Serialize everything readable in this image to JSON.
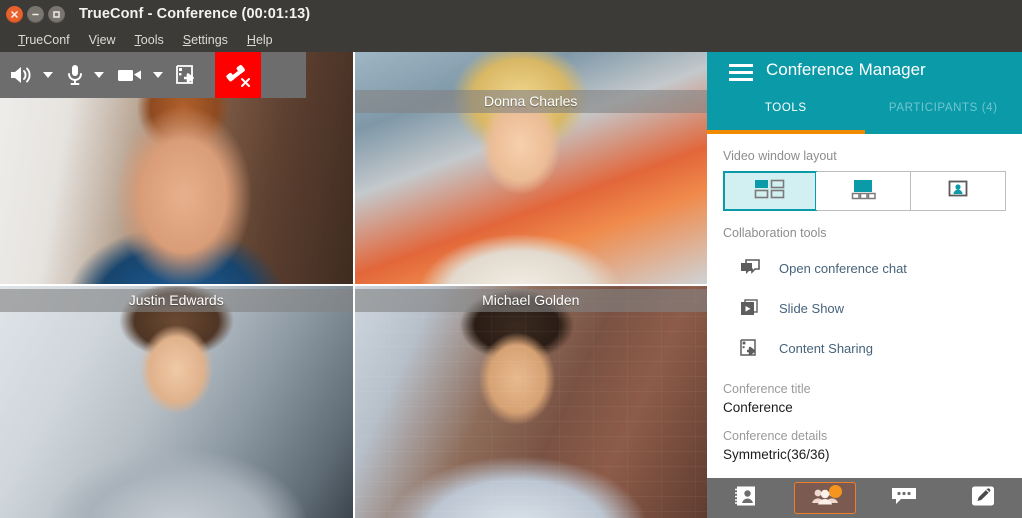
{
  "window": {
    "title": "TrueConf - Conference (00:01:13)",
    "controls": [
      {
        "name": "close",
        "icon": "close-icon"
      },
      {
        "name": "minimize",
        "icon": "minimize-icon"
      },
      {
        "name": "maximize",
        "icon": "maximize-icon"
      }
    ]
  },
  "menubar": {
    "items": [
      {
        "label": "TrueConf",
        "mnemonic": "T"
      },
      {
        "label": "View",
        "mnemonic": "V"
      },
      {
        "label": "Tools",
        "mnemonic": "T"
      },
      {
        "label": "Settings",
        "mnemonic": "S"
      },
      {
        "label": "Help",
        "mnemonic": "H"
      }
    ]
  },
  "toolbar": {
    "buttons": [
      {
        "name": "speaker-button",
        "icon": "speaker-icon",
        "has_dropdown": true
      },
      {
        "name": "microphone-button",
        "icon": "microphone-icon",
        "has_dropdown": true
      },
      {
        "name": "camera-button",
        "icon": "camera-icon",
        "has_dropdown": true
      },
      {
        "name": "content-share-button",
        "icon": "content-share-icon",
        "has_dropdown": false
      },
      {
        "name": "hangup-button",
        "icon": "hangup-icon",
        "has_dropdown": false
      }
    ],
    "hangup_color": "#ff0000"
  },
  "video_grid": {
    "participants": [
      {
        "name": "",
        "position": "top-left"
      },
      {
        "name": "Donna Charles",
        "position": "top-right"
      },
      {
        "name": "Justin Edwards",
        "position": "bottom-left"
      },
      {
        "name": "Michael Golden",
        "position": "bottom-right"
      }
    ]
  },
  "panel": {
    "header": {
      "title": "Conference Manager",
      "menu_icon": "hamburger-icon",
      "background": "#0b9aa8"
    },
    "tabs": [
      {
        "label": "TOOLS",
        "active": true
      },
      {
        "label": "PARTICIPANTS (4)",
        "active": false
      }
    ],
    "accent_color": "#f08a00",
    "layout_section": {
      "label": "Video window layout",
      "options": [
        {
          "name": "grid-layout",
          "icon": "grid-layout-icon",
          "selected": true
        },
        {
          "name": "speaker-layout",
          "icon": "speaker-layout-icon",
          "selected": false
        },
        {
          "name": "single-layout",
          "icon": "single-layout-icon",
          "selected": false
        }
      ]
    },
    "collaboration_section": {
      "label": "Collaboration tools",
      "tools": [
        {
          "label": "Open conference chat",
          "icon": "chat-icon"
        },
        {
          "label": "Slide Show",
          "icon": "slideshow-icon"
        },
        {
          "label": "Content Sharing",
          "icon": "content-sharing-icon"
        }
      ]
    },
    "info": {
      "title_label": "Conference title",
      "title_value": "Conference",
      "details_label": "Conference details",
      "details_value": "Symmetric(36/36)"
    }
  },
  "bottom_bar": {
    "buttons": [
      {
        "name": "address-book-tab",
        "icon": "address-book-icon",
        "active": false,
        "badge": false
      },
      {
        "name": "participants-tab",
        "icon": "group-icon",
        "active": true,
        "badge": true
      },
      {
        "name": "chat-tab",
        "icon": "chat-bubble-icon",
        "active": false,
        "badge": false
      },
      {
        "name": "whiteboard-tab",
        "icon": "pen-icon",
        "active": false,
        "badge": false
      }
    ]
  }
}
